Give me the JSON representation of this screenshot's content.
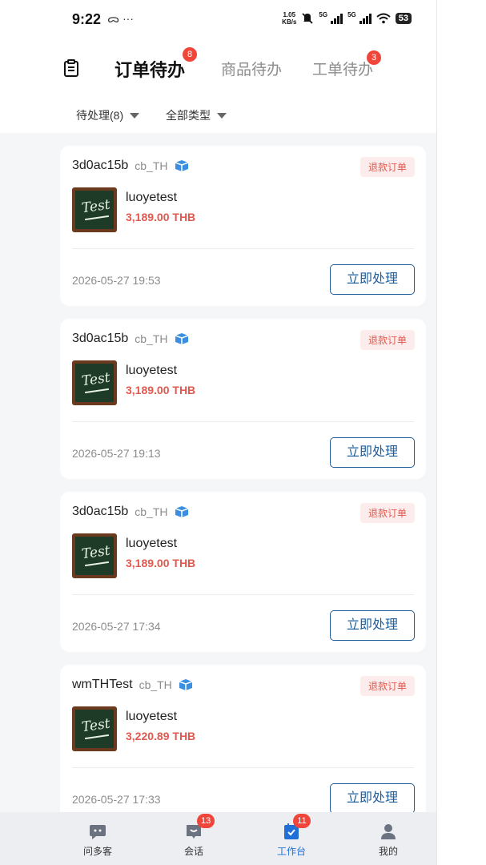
{
  "status_bar": {
    "time": "9:22",
    "left_icons": "ᯅ ···",
    "speed_top": "1.05",
    "speed_bottom": "KB/s",
    "net1": "5G",
    "net2": "5G",
    "battery": "53"
  },
  "header": {
    "tabs": [
      {
        "label": "订单待办",
        "badge": "8",
        "active": true
      },
      {
        "label": "商品待办",
        "badge": "",
        "active": false
      },
      {
        "label": "工单待办",
        "badge": "3",
        "active": false
      }
    ]
  },
  "filters": {
    "status": "待处理(8)",
    "type": "全部类型"
  },
  "orders": [
    {
      "id": "3d0ac15b",
      "shop": "cb_TH",
      "tag": "退款订单",
      "product": "luoyetest",
      "price": "3,189.00 THB",
      "time": "2026-05-27 19:53",
      "action": "立即处理",
      "thumb_text": "Test"
    },
    {
      "id": "3d0ac15b",
      "shop": "cb_TH",
      "tag": "退款订单",
      "product": "luoyetest",
      "price": "3,189.00 THB",
      "time": "2026-05-27 19:13",
      "action": "立即处理",
      "thumb_text": "Test"
    },
    {
      "id": "3d0ac15b",
      "shop": "cb_TH",
      "tag": "退款订单",
      "product": "luoyetest",
      "price": "3,189.00 THB",
      "time": "2026-05-27 17:34",
      "action": "立即处理",
      "thumb_text": "Test"
    },
    {
      "id": "wmTHTest",
      "shop": "cb_TH",
      "tag": "退款订单",
      "product": "luoyetest",
      "price": "3,220.89 THB",
      "time": "2026-05-27 17:33",
      "action": "立即处理",
      "thumb_text": "Test"
    }
  ],
  "bottom_nav": [
    {
      "label": "问多客",
      "badge": "",
      "icon": "chat-bot-icon",
      "active": false
    },
    {
      "label": "会话",
      "badge": "13",
      "icon": "conversation-icon",
      "active": false
    },
    {
      "label": "工作台",
      "badge": "11",
      "icon": "workbench-icon",
      "active": true
    },
    {
      "label": "我的",
      "badge": "",
      "icon": "profile-icon",
      "active": false
    }
  ],
  "colors": {
    "accent": "#1f5d99",
    "nav_active": "#1f6fd6",
    "badge": "#f0453a",
    "price": "#e2584e",
    "tag_bg": "#fdecec"
  }
}
